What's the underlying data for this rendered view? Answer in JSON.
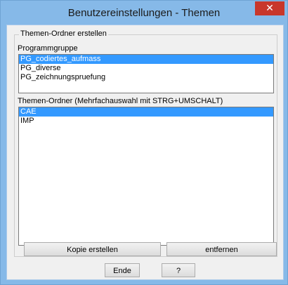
{
  "window": {
    "title": "Benutzereinstellungen - Themen",
    "close_glyph": "✕"
  },
  "group": {
    "legend": "Themen-Ordner erstellen",
    "programmgruppe_label": "Programmgruppe",
    "programmgruppe_items": [
      {
        "label": "PG_codiertes_aufmass",
        "selected": true
      },
      {
        "label": "PG_diverse",
        "selected": false
      },
      {
        "label": "PG_zeichnungspruefung",
        "selected": false
      }
    ],
    "themen_label": "Themen-Ordner (Mehrfachauswahl mit STRG+UMSCHALT)",
    "themen_items": [
      {
        "label": "CAE",
        "selected": true
      },
      {
        "label": "IMP",
        "selected": false
      }
    ]
  },
  "buttons": {
    "kopie": "Kopie erstellen",
    "entfernen": "entfernen",
    "ende": "Ende",
    "help": "?"
  }
}
